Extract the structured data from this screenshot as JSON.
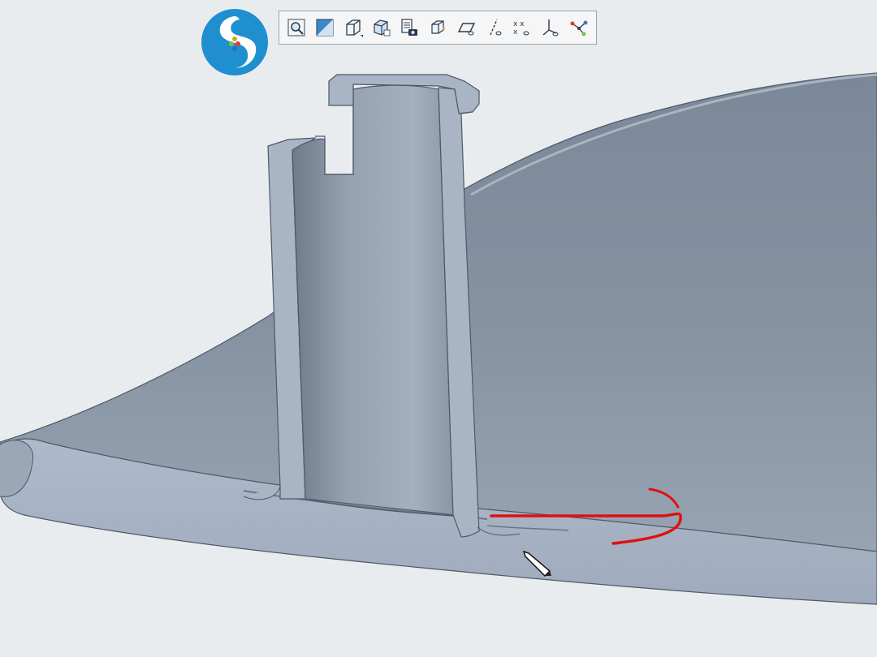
{
  "app": {
    "logo_icon": "app-logo-icon",
    "accent_color": "#1f8fcf"
  },
  "toolbar": {
    "items": [
      {
        "name": "zoom-icon"
      },
      {
        "name": "refit-icon"
      },
      {
        "name": "display-style-icon"
      },
      {
        "name": "saved-orientations-icon"
      },
      {
        "name": "view-manager-icon"
      },
      {
        "name": "spin-center-icon"
      },
      {
        "name": "datum-planes-icon"
      },
      {
        "name": "datum-axes-icon"
      },
      {
        "name": "datum-points-icon"
      },
      {
        "name": "coordinate-systems-icon"
      },
      {
        "name": "annotation-display-icon"
      }
    ]
  },
  "viewport": {
    "model_color": "#8e9aa8",
    "section_color": "#a9b6c6",
    "markup_color": "#e01010",
    "cursor_icon": "pencil-cursor-icon"
  }
}
